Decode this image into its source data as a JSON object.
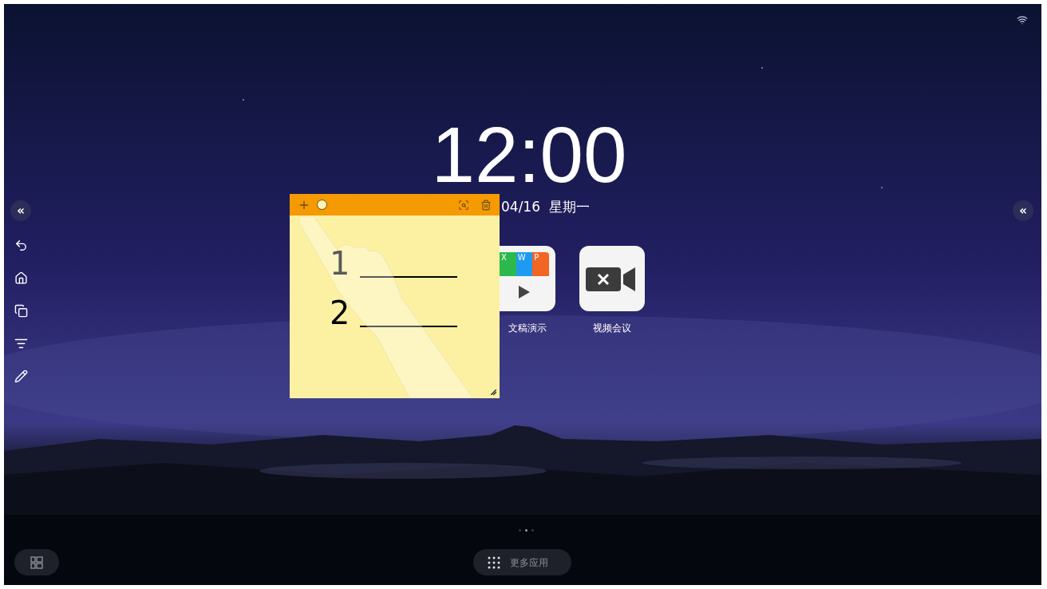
{
  "clock": {
    "time": "12:00",
    "date": "04/16  星期一"
  },
  "left_toolbar": {
    "collapse": "«",
    "tools": [
      {
        "kind": "back"
      },
      {
        "kind": "home"
      },
      {
        "kind": "windows"
      },
      {
        "kind": "list"
      },
      {
        "kind": "pen"
      }
    ]
  },
  "right_toolbar": {
    "collapse": "«"
  },
  "apps": [
    {
      "kind": "docs",
      "label": "文稿演示",
      "tile_letters": [
        "X",
        "W",
        "P"
      ]
    },
    {
      "kind": "video",
      "label": "视频会议"
    }
  ],
  "sticky_note": {
    "lines": [
      {
        "number": "1"
      },
      {
        "number": "2"
      }
    ]
  },
  "pages": [
    {
      "selected": false
    },
    {
      "selected": true
    },
    {
      "selected": false
    }
  ],
  "more_apps": {
    "label": "更多应用"
  }
}
